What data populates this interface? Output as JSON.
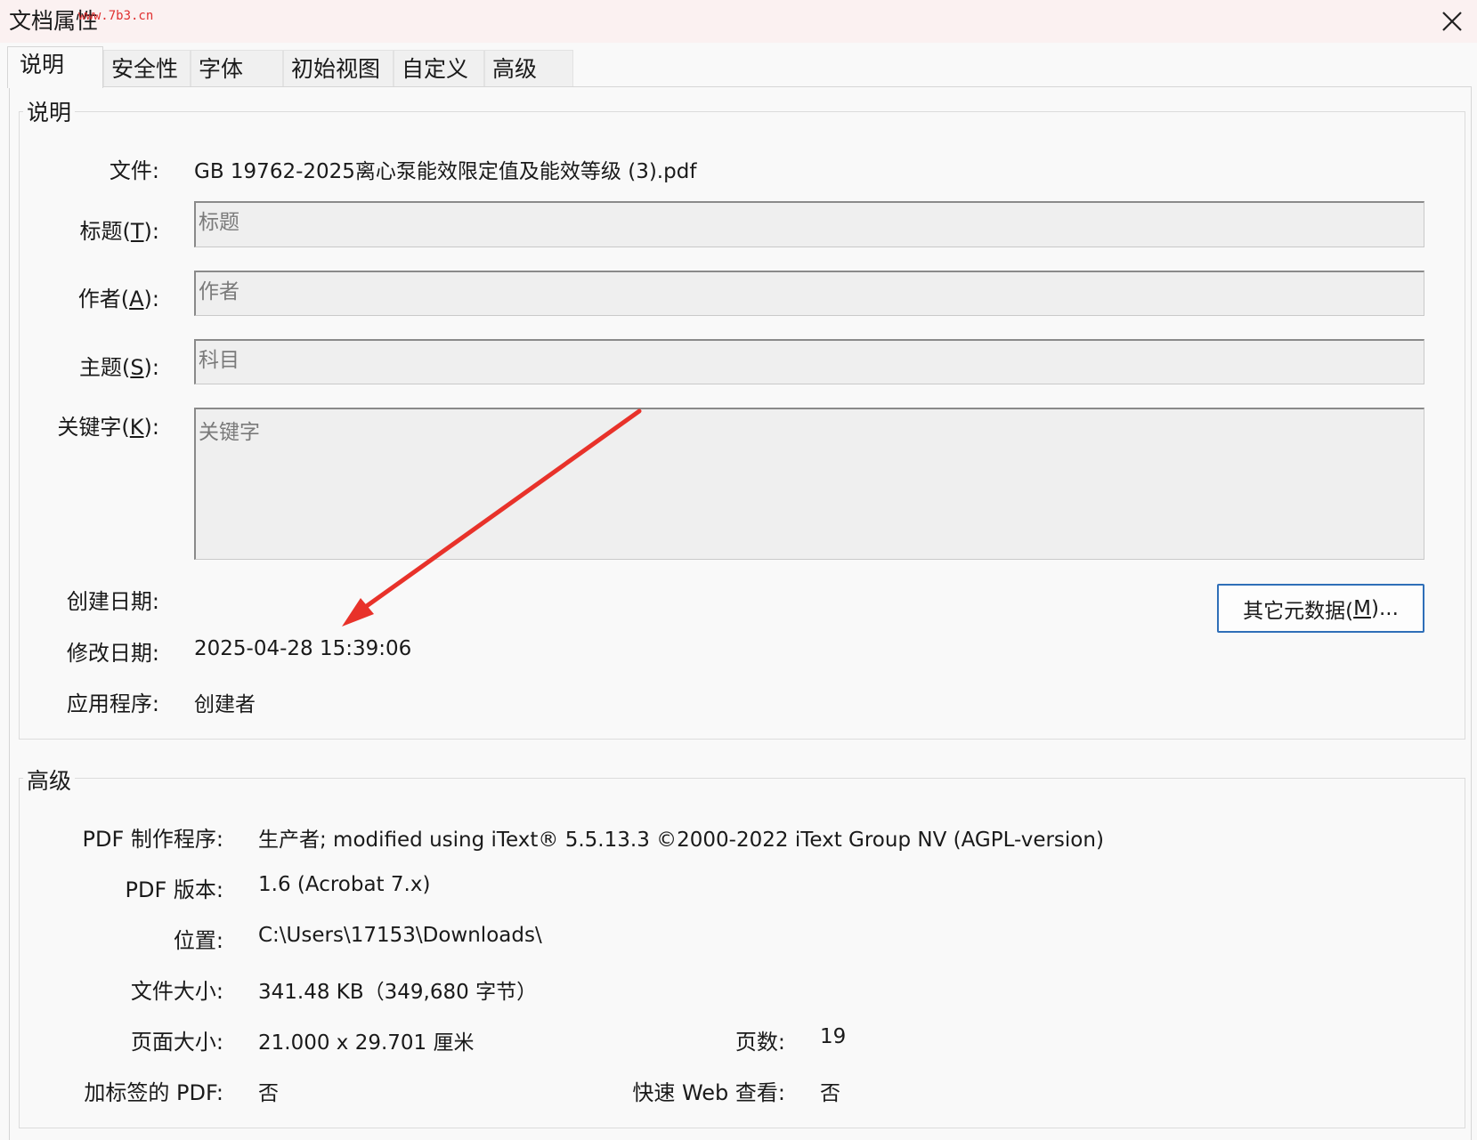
{
  "window": {
    "title": "文档属性",
    "watermark": "www.7b3.cn"
  },
  "tabs": [
    {
      "label": "说明",
      "active": true
    },
    {
      "label": "安全性",
      "active": false
    },
    {
      "label": "字体",
      "active": false
    },
    {
      "label": "初始视图",
      "active": false
    },
    {
      "label": "自定义",
      "active": false
    },
    {
      "label": "高级",
      "active": false
    }
  ],
  "description": {
    "legend": "说明",
    "file_label": "文件:",
    "file_value": "GB 19762-2025离心泵能效限定值及能效等级 (3).pdf",
    "title_label_pre": "标题(",
    "title_label_key": "T",
    "title_label_post": "):",
    "title_placeholder": "标题",
    "author_label_pre": "作者(",
    "author_label_key": "A",
    "author_label_post": "):",
    "author_placeholder": "作者",
    "subject_label_pre": "主题(",
    "subject_label_key": "S",
    "subject_label_post": "):",
    "subject_placeholder": "科目",
    "keywords_label_pre": "关键字(",
    "keywords_label_key": "K",
    "keywords_label_post": "):",
    "keywords_placeholder": "关键字",
    "created_label": "创建日期:",
    "created_value": "",
    "modified_label": "修改日期:",
    "modified_value": "2025-04-28 15:39:06",
    "app_label": "应用程序:",
    "app_value": "创建者",
    "more_meta_pre": "其它元数据(",
    "more_meta_key": "M",
    "more_meta_post": ")..."
  },
  "advanced": {
    "legend": "高级",
    "producer_label": "PDF 制作程序:",
    "producer_value": "生产者; modified using iText® 5.5.13.3 ©2000-2022 iText Group NV (AGPL-version)",
    "version_label": "PDF 版本:",
    "version_value": "1.6 (Acrobat 7.x)",
    "location_label": "位置:",
    "location_value": "C:\\Users\\17153\\Downloads\\",
    "filesize_label": "文件大小:",
    "filesize_value": "341.48 KB（349,680 字节）",
    "pagesize_label": "页面大小:",
    "pagesize_value": "21.000 x 29.701 厘米",
    "pages_label": "页数:",
    "pages_value": "19",
    "tagged_label": "加标签的 PDF:",
    "tagged_value": "否",
    "fastweb_label": "快速 Web 查看:",
    "fastweb_value": "否"
  },
  "annotation": {
    "arrow_color": "#e8322a"
  }
}
